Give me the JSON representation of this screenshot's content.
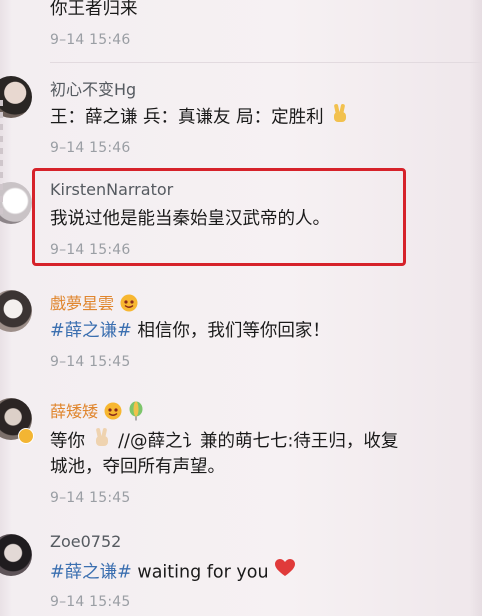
{
  "comments": [
    {
      "name": "",
      "text": "你王者归来",
      "time": "9–14 15:46"
    },
    {
      "name": "初心不变Hg",
      "text": "王：薛之谦 兵：真谦友 局：定胜利",
      "time": "9–14 15:46",
      "emoji": "victory-hand"
    },
    {
      "name": "KirstenNarrator",
      "text": "我说过他是能当秦始皇汉武帝的人。",
      "time": "9–14 15:46",
      "highlighted": true
    },
    {
      "name": "戲夢星雲",
      "name_emoji": "smiling-face",
      "hashtag": "#薛之谦#",
      "text": " 相信你，我们等你回家！",
      "time": "9–14 15:45"
    },
    {
      "name": "薛矮矮",
      "name_emoji": "smiling-face-balloon",
      "text_line1_prefix": "等你",
      "text_line1_suffix": "//@薛之讠兼的萌七七:待王归，收复",
      "text_line2": "城池，夺回所有声望。",
      "time": "9–14 15:45"
    },
    {
      "name": "Zoe0752",
      "hashtag": "#薛之谦#",
      "text": " waiting for you",
      "time": "9–14 15:45",
      "emoji": "red-heart"
    }
  ],
  "colors": {
    "highlight_border": "#d6222a",
    "hashtag": "#3b6fb0",
    "vip_name": "#e0862e"
  }
}
